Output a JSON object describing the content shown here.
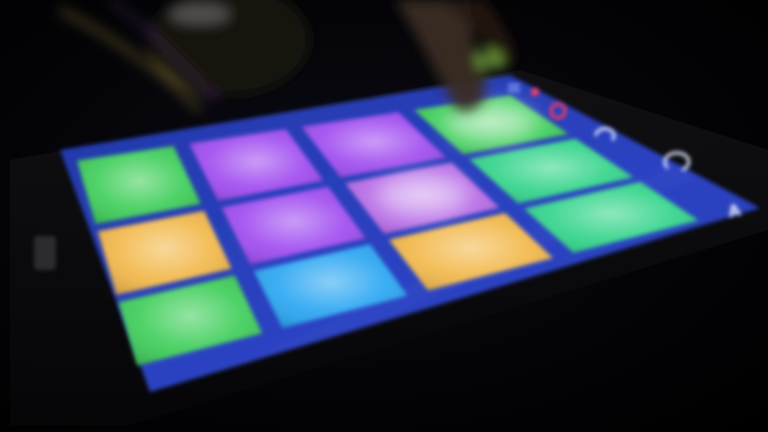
{
  "colors": {
    "background": "#000000",
    "panel": "#2b3fb7",
    "panel_edge": "#1c2a86",
    "pad_green": "#3fce5a",
    "pad_purple": "#a04cf0",
    "pad_violet": "#b66ae6",
    "pad_yellow": "#f2b84a",
    "pad_blue": "#2aa6f2",
    "pad_teal": "#33d48a"
  },
  "pads": [
    {
      "row": 1,
      "col": 1,
      "color_key": "pad_green",
      "glow": false
    },
    {
      "row": 1,
      "col": 2,
      "color_key": "pad_purple",
      "glow": false
    },
    {
      "row": 1,
      "col": 3,
      "color_key": "pad_purple",
      "glow": false
    },
    {
      "row": 1,
      "col": 4,
      "color_key": "pad_green",
      "glow": true
    },
    {
      "row": 2,
      "col": 1,
      "color_key": "pad_yellow",
      "glow": false
    },
    {
      "row": 2,
      "col": 2,
      "color_key": "pad_purple",
      "glow": false
    },
    {
      "row": 2,
      "col": 3,
      "color_key": "pad_violet",
      "glow": true
    },
    {
      "row": 2,
      "col": 4,
      "color_key": "pad_teal",
      "glow": false
    },
    {
      "row": 3,
      "col": 1,
      "color_key": "pad_green",
      "glow": false
    },
    {
      "row": 3,
      "col": 2,
      "color_key": "pad_blue",
      "glow": false
    },
    {
      "row": 3,
      "col": 3,
      "color_key": "pad_yellow",
      "glow": false
    },
    {
      "row": 3,
      "col": 4,
      "color_key": "pad_teal",
      "glow": false
    }
  ],
  "side_controls": {
    "icons": [
      "menu-icon",
      "record-icon",
      "stop-icon",
      "redo-icon",
      "loop-icon",
      "up-icon"
    ],
    "label_a": "A"
  }
}
